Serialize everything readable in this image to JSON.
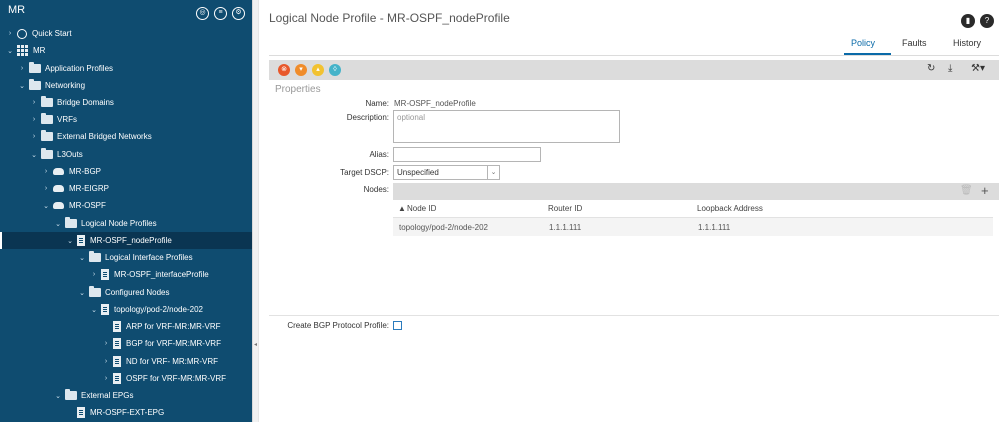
{
  "sidebar": {
    "title": "MR",
    "header_icons": [
      "filter-icon",
      "list-icon",
      "settings-icon"
    ],
    "items": [
      {
        "label": "Quick Start",
        "icon": "quickstart-icon",
        "expanded": false
      },
      {
        "label": "MR",
        "icon": "tenant-icon",
        "expanded": true
      },
      {
        "label": "Application Profiles",
        "icon": "folder-icon",
        "expanded": false
      },
      {
        "label": "Networking",
        "icon": "folder-icon",
        "expanded": true
      },
      {
        "label": "Bridge Domains",
        "icon": "folder-icon",
        "expanded": false
      },
      {
        "label": "VRFs",
        "icon": "folder-icon",
        "expanded": false
      },
      {
        "label": "External Bridged Networks",
        "icon": "folder-icon",
        "expanded": false
      },
      {
        "label": "L3Outs",
        "icon": "folder-icon",
        "expanded": true
      },
      {
        "label": "MR-BGP",
        "icon": "cloud-icon",
        "expanded": false
      },
      {
        "label": "MR-EIGRP",
        "icon": "cloud-icon",
        "expanded": false
      },
      {
        "label": "MR-OSPF",
        "icon": "cloud-icon",
        "expanded": true
      },
      {
        "label": "Logical Node Profiles",
        "icon": "folder-icon",
        "expanded": true
      },
      {
        "label": "MR-OSPF_nodeProfile",
        "icon": "document-icon",
        "expanded": true,
        "selected": true
      },
      {
        "label": "Logical Interface Profiles",
        "icon": "folder-icon",
        "expanded": true
      },
      {
        "label": "MR-OSPF_interfaceProfile",
        "icon": "document-icon",
        "expanded": false
      },
      {
        "label": "Configured Nodes",
        "icon": "folder-icon",
        "expanded": true
      },
      {
        "label": "topology/pod-2/node-202",
        "icon": "document-icon",
        "expanded": true
      },
      {
        "label": "ARP for VRF-MR:MR-VRF",
        "icon": "document-icon",
        "expanded": false,
        "leaf": true
      },
      {
        "label": "BGP for VRF-MR:MR-VRF",
        "icon": "document-icon",
        "expanded": false
      },
      {
        "label": "ND for VRF- MR:MR-VRF",
        "icon": "document-icon",
        "expanded": false
      },
      {
        "label": "OSPF for VRF-MR:MR-VRF",
        "icon": "document-icon",
        "expanded": false
      },
      {
        "label": "External EPGs",
        "icon": "folder-icon",
        "expanded": true
      },
      {
        "label": "MR-OSPF-EXT-EPG",
        "icon": "document-icon",
        "expanded": false,
        "leaf": true
      }
    ]
  },
  "header": {
    "title": "Logical Node Profile - MR-OSPF_nodeProfile",
    "icons": [
      "bookmark-icon",
      "help-icon"
    ]
  },
  "tabs": [
    {
      "label": "Policy",
      "active": true
    },
    {
      "label": "Faults",
      "active": false
    },
    {
      "label": "History",
      "active": false
    }
  ],
  "toolbar": {
    "status_icons": [
      {
        "name": "critical-fault-icon",
        "color": "#e8572a"
      },
      {
        "name": "major-fault-icon",
        "color": "#f08c2a"
      },
      {
        "name": "minor-fault-icon",
        "color": "#f2c230"
      },
      {
        "name": "warning-fault-icon",
        "color": "#45b3c9"
      }
    ],
    "actions": [
      "refresh-icon",
      "download-icon",
      "tools-icon"
    ]
  },
  "properties": {
    "section_label": "Properties",
    "name_label": "Name:",
    "name_value": "MR-OSPF_nodeProfile",
    "description_label": "Description:",
    "description_placeholder": "optional",
    "alias_label": "Alias:",
    "alias_value": "",
    "target_dscp_label": "Target DSCP:",
    "target_dscp_value": "Unspecified",
    "nodes_label": "Nodes:",
    "create_bgp_label": "Create BGP Protocol Profile:",
    "create_bgp_checked": false
  },
  "nodes_table": {
    "columns": [
      "Node ID",
      "Router ID",
      "Loopback Address"
    ],
    "sort_indicator": "▲",
    "rows": [
      {
        "node_id": "topology/pod-2/node-202",
        "router_id": "1.1.1.111",
        "loopback": "1.1.1.111"
      }
    ]
  },
  "colors": {
    "sidebar_bg": "#0f4c70",
    "accent": "#0a6aa8"
  }
}
